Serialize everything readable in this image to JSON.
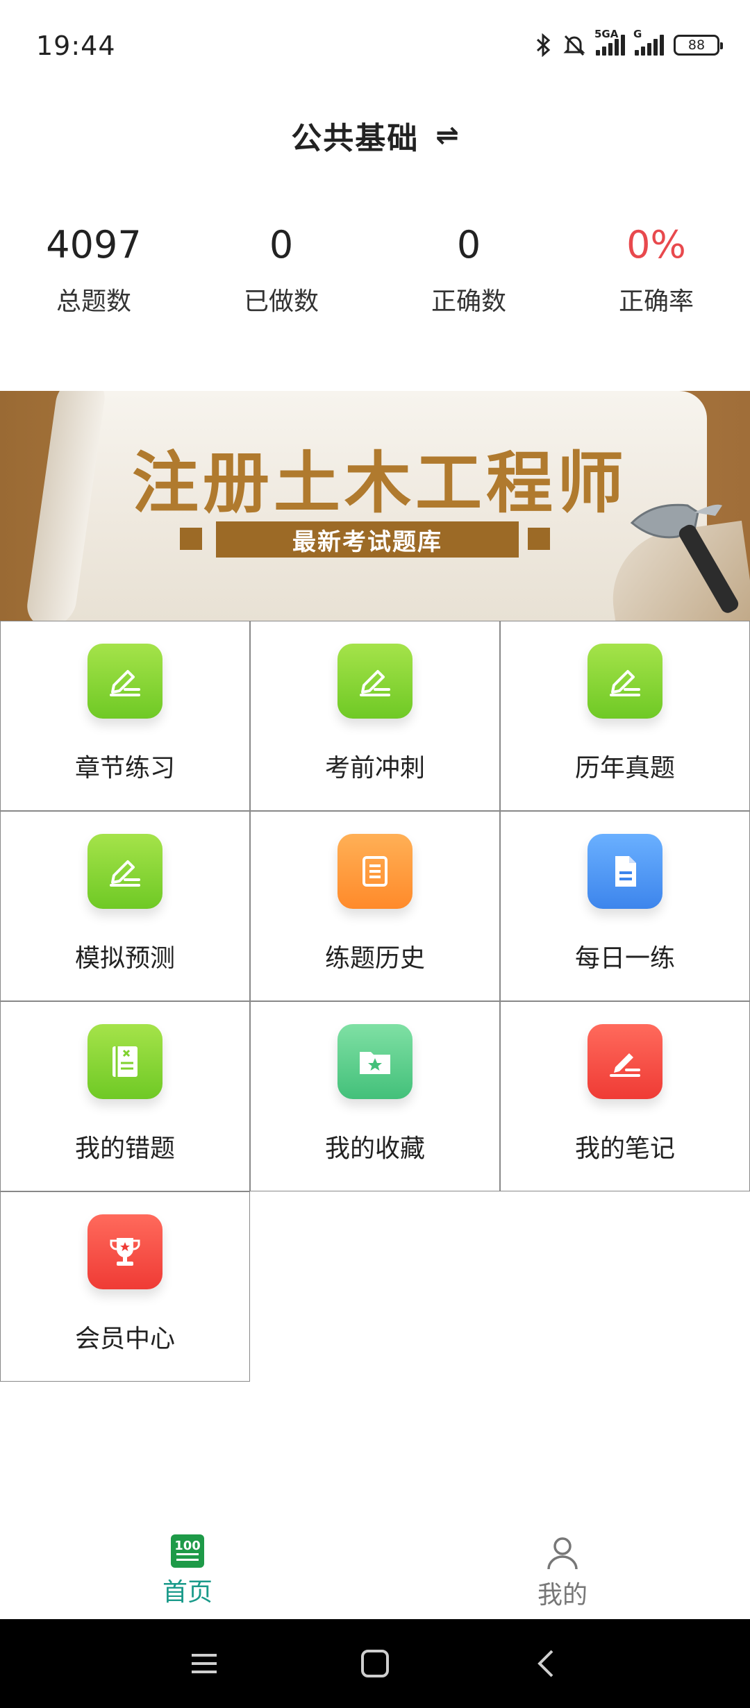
{
  "status": {
    "time": "19:44",
    "network1": "5GA",
    "network2": "G",
    "battery": "88"
  },
  "header": {
    "title": "公共基础",
    "switch_icon": "⇌"
  },
  "stats": [
    {
      "value": "4097",
      "label": "总题数"
    },
    {
      "value": "0",
      "label": "已做数"
    },
    {
      "value": "0",
      "label": "正确数"
    },
    {
      "value": "0%",
      "label": "正确率"
    }
  ],
  "banner": {
    "title": "注册土木工程师",
    "subtitle": "最新考试题库"
  },
  "menu": [
    {
      "label": "章节练习",
      "icon": "edit-icon"
    },
    {
      "label": "考前冲刺",
      "icon": "edit-icon"
    },
    {
      "label": "历年真题",
      "icon": "edit-icon"
    },
    {
      "label": "模拟预测",
      "icon": "edit-icon"
    },
    {
      "label": "练题历史",
      "icon": "scroll-list-icon"
    },
    {
      "label": "每日一练",
      "icon": "document-icon"
    },
    {
      "label": "我的错题",
      "icon": "wrong-notebook-icon"
    },
    {
      "label": "我的收藏",
      "icon": "star-folder-icon"
    },
    {
      "label": "我的笔记",
      "icon": "note-edit-icon"
    },
    {
      "label": "会员中心",
      "icon": "trophy-icon"
    }
  ],
  "tabbar": {
    "home_label": "首页",
    "home_icon_text": "100",
    "me_label": "我的"
  },
  "colors": {
    "accent_teal": "#1a9a8a",
    "red": "#e8494d",
    "green_icon": "#7fd12e",
    "banner_brown": "#9c6a26"
  }
}
